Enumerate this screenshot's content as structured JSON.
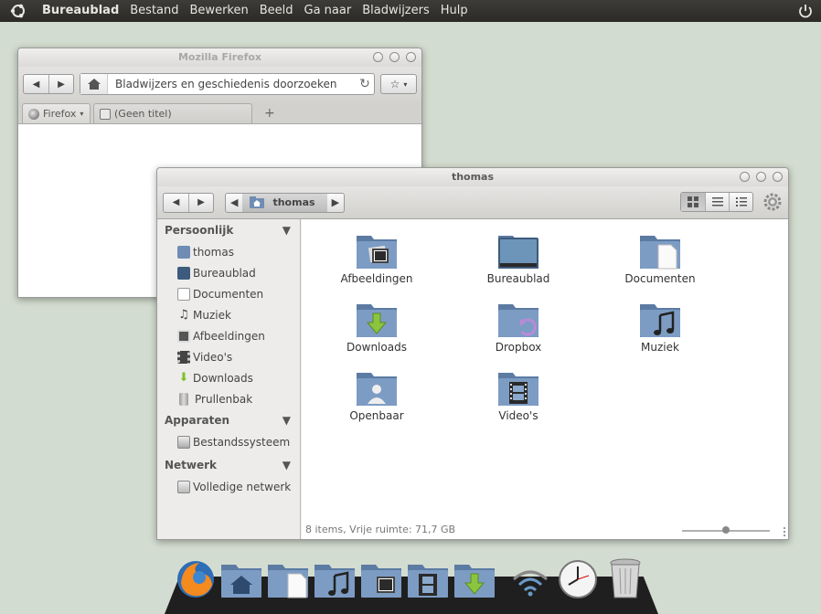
{
  "top_panel": {
    "menu": [
      "Bureaublad",
      "Bestand",
      "Bewerken",
      "Beeld",
      "Ga naar",
      "Bladwijzers",
      "Hulp"
    ]
  },
  "firefox": {
    "title": "Mozilla Firefox",
    "url_placeholder": "Bladwijzers en geschiedenis doorzoeken",
    "tab_menu": "Firefox",
    "tab_title": "(Geen titel)",
    "new_tab": "+"
  },
  "nautilus": {
    "title": "thomas",
    "crumb": "thomas",
    "sidebar": {
      "personal_header": "Persoonlijk",
      "personal": [
        "thomas",
        "Bureaublad",
        "Documenten",
        "Muziek",
        "Afbeeldingen",
        "Video's",
        "Downloads",
        "Prullenbak"
      ],
      "devices_header": "Apparaten",
      "devices": [
        "Bestandssysteem"
      ],
      "network_header": "Netwerk",
      "network": [
        "Volledige netwerk"
      ]
    },
    "files": [
      "Afbeeldingen",
      "Bureaublad",
      "Documenten",
      "Downloads",
      "Dropbox",
      "Muziek",
      "Openbaar",
      "Video's"
    ],
    "status": "8 items, Vrije ruimte: 71,7 GB",
    "zoom_fraction": 0.5
  },
  "colors": {
    "folder": "#6f8db4",
    "panel": "#2f2e2b",
    "desktop": "#d3dcd0"
  }
}
